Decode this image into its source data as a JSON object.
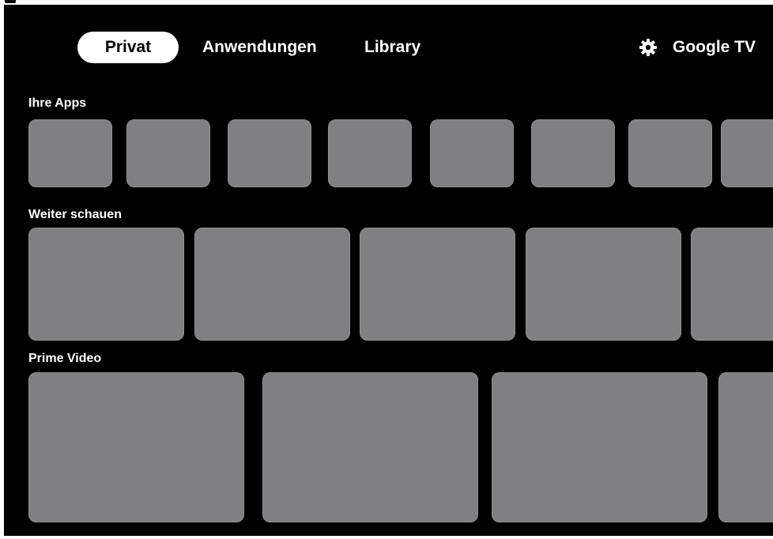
{
  "header_caption": "",
  "nav": {
    "tabs": [
      {
        "label": "Privat",
        "active": true
      },
      {
        "label": "Anwendungen",
        "active": false
      },
      {
        "label": "Library",
        "active": false
      }
    ],
    "settings_icon": "gear-icon",
    "brand": "Google TV"
  },
  "rows": {
    "apps": {
      "title": "Ihre Apps",
      "card_count": 8
    },
    "continue": {
      "title": "Weiter schauen",
      "card_count": 5
    },
    "prime": {
      "title": "Prime Video",
      "card_count": 4
    }
  },
  "colors": {
    "background": "#000000",
    "card": "#808083",
    "active_tab": "#ffffff",
    "text": "#ffffff"
  }
}
